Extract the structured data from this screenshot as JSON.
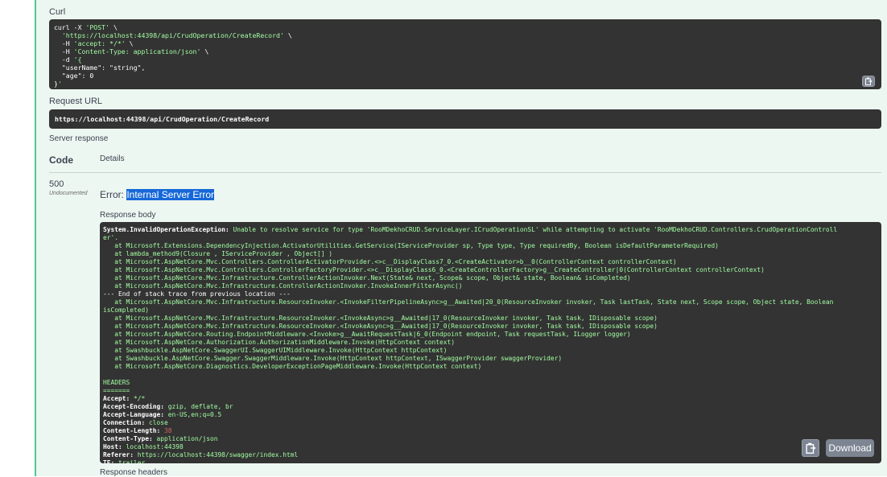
{
  "curl": {
    "label": "Curl",
    "lines": [
      "curl -X 'POST' \\",
      "  'https://localhost:44398/api/CrudOperation/CreateRecord' \\",
      "  -H 'accept: */*' \\",
      "  -H 'Content-Type: application/json' \\",
      "  -d '{",
      "  \"userName\": \"string\",",
      "  \"age\": 0",
      "}'"
    ]
  },
  "request_url": {
    "label": "Request URL",
    "value": "https://localhost:44398/api/CrudOperation/CreateRecord"
  },
  "server_response": {
    "label": "Server response",
    "col_code": "Code",
    "col_details": "Details",
    "code": "500",
    "code_note": "Undocumented",
    "error_prefix": "Error: ",
    "error_text": "Internal Server Error",
    "body_label": "Response body",
    "body_lines": [
      "System.InvalidOperationException: Unable to resolve service for type 'RooMDekhoCRUD.ServiceLayer.ICrudOperationSL' while attempting to activate 'RooMDekhoCRUD.Controllers.CrudOperationControll",
      "er'.",
      "   at Microsoft.Extensions.DependencyInjection.ActivatorUtilities.GetService(IServiceProvider sp, Type type, Type requiredBy, Boolean isDefaultParameterRequired)",
      "   at lambda_method9(Closure , IServiceProvider , Object[] )",
      "   at Microsoft.AspNetCore.Mvc.Controllers.ControllerActivatorProvider.<>c__DisplayClass7_0.<CreateActivator>b__0(ControllerContext controllerContext)",
      "   at Microsoft.AspNetCore.Mvc.Controllers.ControllerFactoryProvider.<>c__DisplayClass6_0.<CreateControllerFactory>g__CreateController|0(ControllerContext controllerContext)",
      "   at Microsoft.AspNetCore.Mvc.Infrastructure.ControllerActionInvoker.Next(State& next, Scope& scope, Object& state, Boolean& isCompleted)",
      "   at Microsoft.AspNetCore.Mvc.Infrastructure.ControllerActionInvoker.InvokeInnerFilterAsync()",
      "--- End of stack trace from previous location ---",
      "   at Microsoft.AspNetCore.Mvc.Infrastructure.ResourceInvoker.<InvokeFilterPipelineAsync>g__Awaited|20_0(ResourceInvoker invoker, Task lastTask, State next, Scope scope, Object state, Boolean",
      "isCompleted)",
      "   at Microsoft.AspNetCore.Mvc.Infrastructure.ResourceInvoker.<InvokeAsync>g__Awaited|17_0(ResourceInvoker invoker, Task task, IDisposable scope)",
      "   at Microsoft.AspNetCore.Mvc.Infrastructure.ResourceInvoker.<InvokeAsync>g__Awaited|17_0(ResourceInvoker invoker, Task task, IDisposable scope)",
      "   at Microsoft.AspNetCore.Routing.EndpointMiddleware.<Invoke>g__AwaitRequestTask|6_0(Endpoint endpoint, Task requestTask, ILogger logger)",
      "   at Microsoft.AspNetCore.Authorization.AuthorizationMiddleware.Invoke(HttpContext context)",
      "   at Swashbuckle.AspNetCore.SwaggerUI.SwaggerUIMiddleware.Invoke(HttpContext httpContext)",
      "   at Swashbuckle.AspNetCore.Swagger.SwaggerMiddleware.Invoke(HttpContext httpContext, ISwaggerProvider swaggerProvider)",
      "   at Microsoft.AspNetCore.Diagnostics.DeveloperExceptionPageMiddleware.Invoke(HttpContext context)",
      "",
      "HEADERS",
      "======="
    ],
    "headers": [
      {
        "k": "Accept:",
        "v": " */*"
      },
      {
        "k": "Accept-Encoding:",
        "v": " gzip, deflate, br"
      },
      {
        "k": "Accept-Language:",
        "v": " en-US,en;q=0.5"
      },
      {
        "k": "Connection:",
        "v": " close"
      },
      {
        "k": "Content-Length:",
        "v": " 38",
        "num": true
      },
      {
        "k": "Content-Type:",
        "v": " application/json"
      },
      {
        "k": "Host:",
        "v": " localhost:44398"
      },
      {
        "k": "Referer:",
        "v": " https://localhost:44398/swagger/index.html"
      },
      {
        "k": "TE:",
        "v": " trailer"
      }
    ],
    "download_label": "Download",
    "headers_label": "Response headers"
  },
  "icons": {
    "copy": "clipboard-copy-icon"
  }
}
